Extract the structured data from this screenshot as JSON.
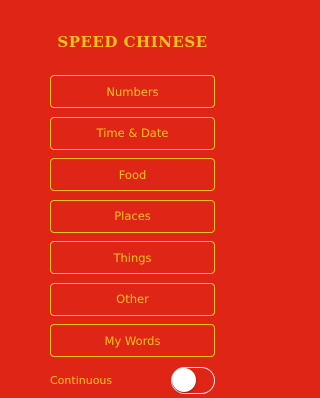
{
  "app": {
    "title": "SPEED CHINESE"
  },
  "menu": {
    "items": [
      {
        "label": "Numbers"
      },
      {
        "label": "Time & Date"
      },
      {
        "label": "Food"
      },
      {
        "label": "Places"
      },
      {
        "label": "Things"
      },
      {
        "label": "Other"
      },
      {
        "label": "My Words"
      }
    ]
  },
  "settings": {
    "continuous_label": "Continuous",
    "continuous_on": false
  },
  "colors": {
    "background": "#df2516",
    "accent": "#f6c21a"
  }
}
